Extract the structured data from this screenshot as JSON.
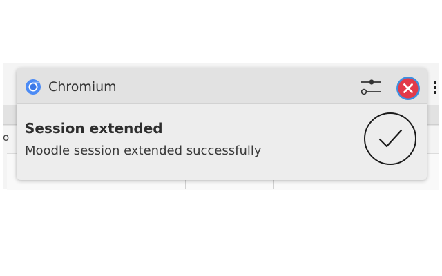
{
  "background": {
    "edge_fragment": "o"
  },
  "notification": {
    "app_name": "Chromium",
    "app_icon": "chromium-icon",
    "settings_icon": "sliders-icon",
    "close_icon": "close-icon",
    "title": "Session extended",
    "message": "Moodle session extended successfully",
    "status_icon": "checkmark-circle-icon"
  },
  "colors": {
    "close_red": "#e23a4a",
    "close_ring": "#3d8fe0",
    "chromium_blue": "#4c8bf5"
  }
}
